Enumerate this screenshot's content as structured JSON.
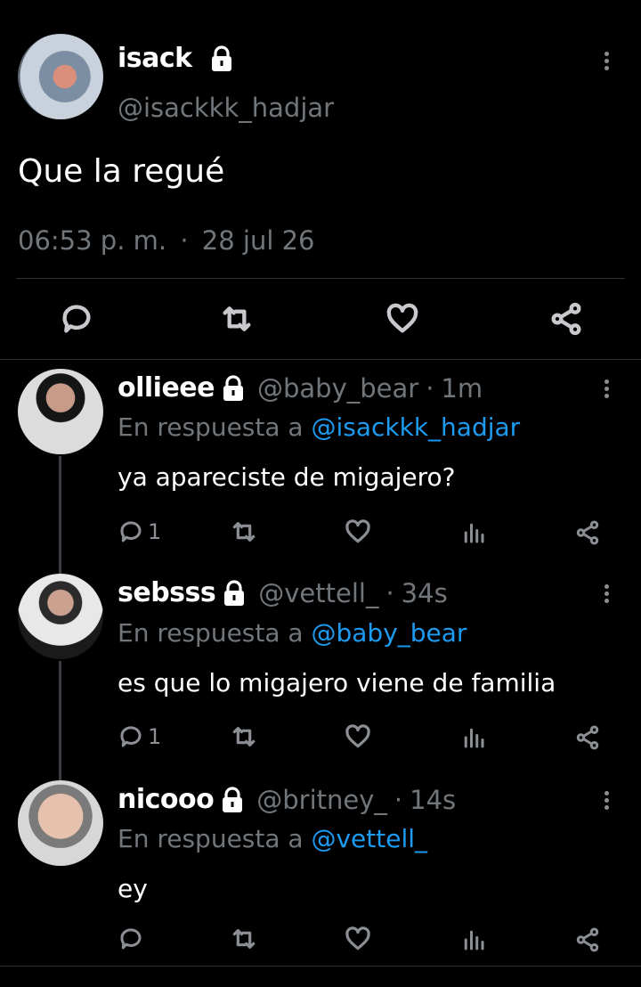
{
  "main_tweet": {
    "name": "isack",
    "handle": "@isackkk_hadjar",
    "text": "Que la regué",
    "time": "06:53 p. m.",
    "separator": "·",
    "date": "28 jul 26"
  },
  "replies": [
    {
      "name": "ollieee",
      "handle": "@baby_bear",
      "time_sep": "·",
      "time": "1m",
      "reply_prefix": "En respuesta a",
      "reply_to": "@isackkk_hadjar",
      "text": "ya apareciste de migajero?",
      "reply_count": "1"
    },
    {
      "name": "sebsss",
      "handle": "@vettell_",
      "time_sep": "·",
      "time": "34s",
      "reply_prefix": "En respuesta a",
      "reply_to": "@baby_bear",
      "text": "es que lo migajero viene de familia",
      "reply_count": "1"
    },
    {
      "name": "nicooo",
      "handle": "@britney_",
      "time_sep": "·",
      "time": "14s",
      "reply_prefix": "En respuesta a",
      "reply_to": "@vettell_",
      "text": "ey",
      "reply_count": ""
    }
  ],
  "icons": {
    "reply": "speech-bubble",
    "retweet": "retweet-arrows",
    "like": "heart",
    "stats": "bar-chart",
    "share": "share-nodes",
    "more": "vertical-dots",
    "lock": "padlock"
  },
  "colors": {
    "background": "#000000",
    "text": "#ffffff",
    "muted": "#71767b",
    "link": "#1d9bf0",
    "divider": "#2f3336"
  }
}
